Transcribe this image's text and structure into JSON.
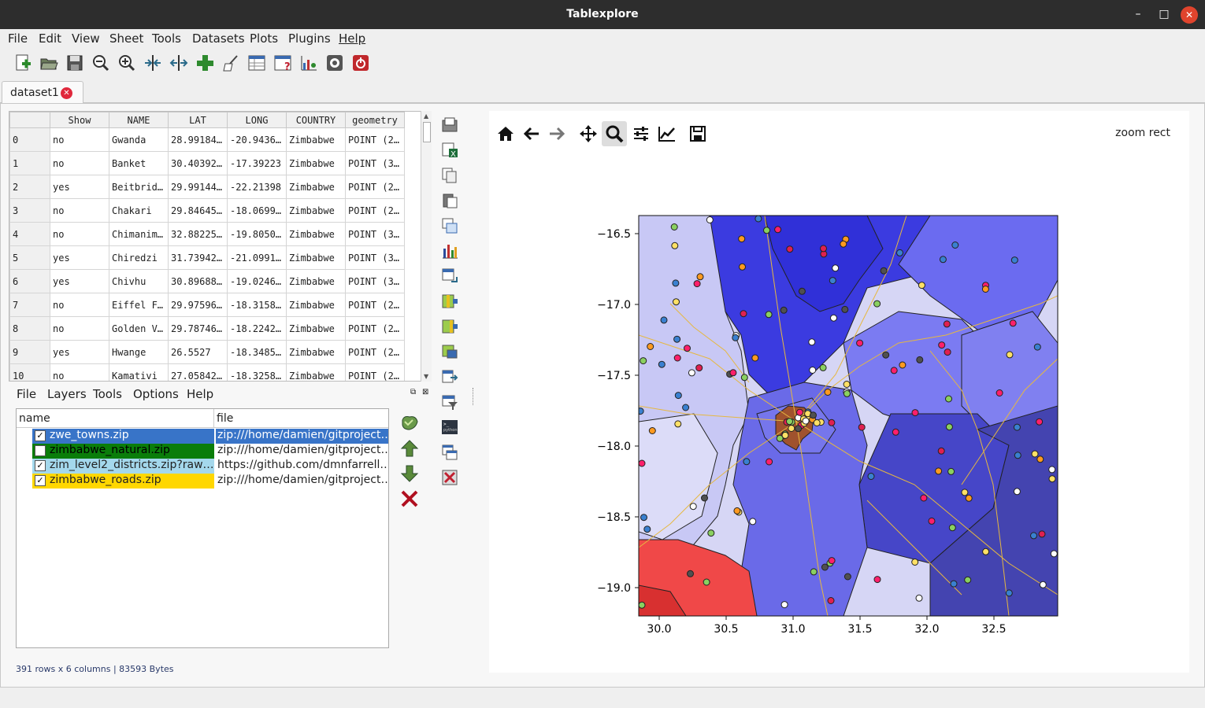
{
  "window": {
    "title": "Tablexplore"
  },
  "menubar": [
    "File",
    "Edit",
    "View",
    "Sheet",
    "Tools",
    "Datasets",
    "Plots",
    "Plugins",
    "Help"
  ],
  "toolbar": [
    "new-icon",
    "open-icon",
    "save-icon",
    "zoom-out-icon",
    "zoom-in-icon",
    "decrease-columns-icon",
    "increase-columns-icon",
    "add-icon",
    "clean-icon",
    "table-info-icon",
    "table-help-icon",
    "plot-icon",
    "settings-icon",
    "quit-icon"
  ],
  "tabs": [
    {
      "label": "dataset1"
    }
  ],
  "table": {
    "columns": [
      "Show",
      "NAME",
      "LAT",
      "LONG",
      "COUNTRY",
      "geometry"
    ],
    "rows": [
      [
        "0",
        "no",
        "Gwanda",
        "28.99184…",
        "-20.9436…",
        "Zimbabwe",
        "POINT (2…"
      ],
      [
        "1",
        "no",
        "Banket",
        "30.40392…",
        "-17.39223",
        "Zimbabwe",
        "POINT (3…"
      ],
      [
        "2",
        "yes",
        "Beitbrid…",
        "29.99144…",
        "-22.21398",
        "Zimbabwe",
        "POINT (2…"
      ],
      [
        "3",
        "no",
        "Chakari",
        "29.84645…",
        "-18.0699…",
        "Zimbabwe",
        "POINT (2…"
      ],
      [
        "4",
        "no",
        "Chimanim…",
        "32.88225…",
        "-19.8050…",
        "Zimbabwe",
        "POINT (3…"
      ],
      [
        "5",
        "yes",
        "Chiredzi",
        "31.73942…",
        "-21.0991…",
        "Zimbabwe",
        "POINT (3…"
      ],
      [
        "6",
        "yes",
        "Chivhu",
        "30.89688…",
        "-19.0246…",
        "Zimbabwe",
        "POINT (3…"
      ],
      [
        "7",
        "no",
        "Eiffel F…",
        "29.97596…",
        "-18.3158…",
        "Zimbabwe",
        "POINT (2…"
      ],
      [
        "8",
        "no",
        "Golden V…",
        "29.78746…",
        "-18.2242…",
        "Zimbabwe",
        "POINT (2…"
      ],
      [
        "9",
        "yes",
        "Hwange",
        "26.5527",
        "-18.3485…",
        "Zimbabwe",
        "POINT (2…"
      ],
      [
        "10",
        "no",
        "Kamativi",
        "27.05842…",
        "-18.3258…",
        "Zimbabwe",
        "POINT (2…"
      ]
    ]
  },
  "side_tools": [
    "open-folder-icon",
    "excel-icon",
    "copy-icon",
    "paste-icon",
    "table-copy-icon",
    "bar-chart-icon",
    "transpose-icon",
    "add-column-icon",
    "add-column-right-icon",
    "merge-icon",
    "convert-icon",
    "filter-icon",
    "python-icon",
    "duplicate-icon",
    "delete-table-icon"
  ],
  "layers_menu": [
    "File",
    "Layers",
    "Tools",
    "Options",
    "Help"
  ],
  "layers": {
    "headers": {
      "name": "name",
      "file": "file"
    },
    "items": [
      {
        "name": "zwe_towns.zip",
        "file": "zip:///home/damien/gitproject…",
        "checked": true,
        "color": "#3874c8",
        "selected": true
      },
      {
        "name": "zimbabwe_natural.zip",
        "file": "zip:///home/damien/gitproject…",
        "checked": false,
        "color": "#0a7d0a",
        "selected": false
      },
      {
        "name": "zim_level2_districts.zip?raw…",
        "file": "https://github.com/dmnfarrell…",
        "checked": true,
        "color": "#a4d8ec",
        "selected": false
      },
      {
        "name": "zimbabwe_roads.zip",
        "file": "zip:///home/damien/gitproject…",
        "checked": true,
        "color": "#ffd700",
        "selected": false
      }
    ]
  },
  "layer_buttons": [
    "layer-style-icon",
    "move-up-icon",
    "move-down-icon",
    "remove-layer-icon"
  ],
  "status": "391 rows x 6 columns | 83593 Bytes",
  "plot_toolbar": {
    "buttons": [
      "home-icon",
      "back-icon",
      "forward-icon",
      "pan-icon",
      "zoom-icon",
      "configure-icon",
      "edit-axis-icon",
      "save-figure-icon"
    ],
    "mode": "zoom rect"
  },
  "map": {
    "xticks": [
      "30.0",
      "30.5",
      "31.0",
      "31.5",
      "32.0",
      "32.5"
    ],
    "yticks": [
      "−16.5",
      "−17.0",
      "−17.5",
      "−18.0",
      "−18.5",
      "−19.0"
    ]
  }
}
